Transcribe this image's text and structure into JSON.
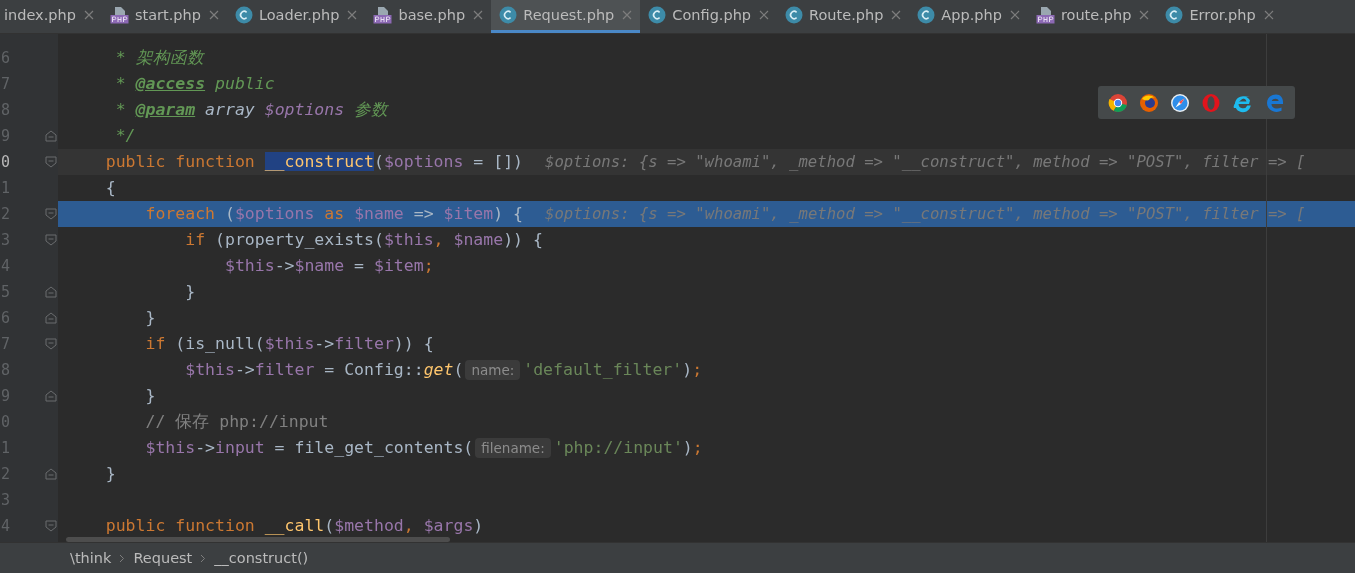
{
  "tabs": [
    {
      "label": "index.php",
      "kind": "plain",
      "selected": false
    },
    {
      "label": "start.php",
      "kind": "php",
      "selected": false
    },
    {
      "label": "Loader.php",
      "kind": "class",
      "selected": false
    },
    {
      "label": "base.php",
      "kind": "php",
      "selected": false
    },
    {
      "label": "Request.php",
      "kind": "class",
      "selected": true
    },
    {
      "label": "Config.php",
      "kind": "class",
      "selected": false
    },
    {
      "label": "Route.php",
      "kind": "class",
      "selected": false
    },
    {
      "label": "App.php",
      "kind": "class",
      "selected": false
    },
    {
      "label": "route.php",
      "kind": "php",
      "selected": false
    },
    {
      "label": "Error.php",
      "kind": "class",
      "selected": false
    }
  ],
  "editor": {
    "lines": [
      {
        "number": "6",
        "kind": "plain",
        "current": false,
        "execution": false,
        "tokens": [
          {
            "kind": "doc",
            "text": "     * 架构函数"
          }
        ]
      },
      {
        "number": "7",
        "kind": "plain",
        "current": false,
        "execution": false,
        "tokens": [
          {
            "kind": "doc",
            "text": "     * "
          },
          {
            "kind": "doctag",
            "text": "@access"
          },
          {
            "kind": "doc",
            "text": " public"
          }
        ]
      },
      {
        "number": "8",
        "kind": "plain",
        "current": false,
        "execution": false,
        "tokens": [
          {
            "kind": "doc",
            "text": "     * "
          },
          {
            "kind": "doctag",
            "text": "@param"
          },
          {
            "kind": "doctype",
            "text": " array "
          },
          {
            "kind": "docvar",
            "text": "$options"
          },
          {
            "kind": "doc",
            "text": " 参数"
          }
        ]
      },
      {
        "number": "9",
        "kind": "fold_end",
        "current": false,
        "execution": false,
        "tokens": [
          {
            "kind": "doc",
            "text": "     */"
          }
        ]
      },
      {
        "number": "0",
        "kind": "fold_start",
        "current": true,
        "execution": false,
        "tokens": [
          {
            "kind": "kw",
            "text": "    public function "
          },
          {
            "kind": "fnsel",
            "text": "__construct"
          },
          {
            "kind": "text",
            "text": "("
          },
          {
            "kind": "var",
            "text": "$options"
          },
          {
            "kind": "text",
            "text": " = [])"
          },
          {
            "kind": "hint",
            "text": "$options: {s => \"whoami\", _method => \"__construct\", method => \"POST\", filter => ["
          }
        ]
      },
      {
        "number": "1",
        "kind": "plain",
        "current": false,
        "execution": false,
        "tokens": [
          {
            "kind": "text",
            "text": "    {"
          }
        ]
      },
      {
        "number": "2",
        "kind": "fold_start",
        "current": false,
        "execution": true,
        "tokens": [
          {
            "kind": "kw",
            "text": "        foreach "
          },
          {
            "kind": "text",
            "text": "("
          },
          {
            "kind": "var",
            "text": "$options"
          },
          {
            "kind": "kw",
            "text": " as "
          },
          {
            "kind": "var",
            "text": "$name"
          },
          {
            "kind": "text",
            "text": " => "
          },
          {
            "kind": "var",
            "text": "$item"
          },
          {
            "kind": "text",
            "text": ") {"
          },
          {
            "kind": "hint",
            "text": "$options: {s => \"whoami\", _method => \"__construct\", method => \"POST\", filter => ["
          }
        ]
      },
      {
        "number": "3",
        "kind": "fold_start",
        "current": false,
        "execution": false,
        "tokens": [
          {
            "kind": "kw",
            "text": "            if "
          },
          {
            "kind": "text",
            "text": "(property_exists("
          },
          {
            "kind": "var",
            "text": "$this"
          },
          {
            "kind": "kw",
            "text": ", "
          },
          {
            "kind": "var",
            "text": "$name"
          },
          {
            "kind": "text",
            "text": ")) {"
          }
        ]
      },
      {
        "number": "4",
        "kind": "plain",
        "current": false,
        "execution": false,
        "tokens": [
          {
            "kind": "var",
            "text": "                $this"
          },
          {
            "kind": "text",
            "text": "->"
          },
          {
            "kind": "var",
            "text": "$name"
          },
          {
            "kind": "text",
            "text": " = "
          },
          {
            "kind": "var",
            "text": "$item"
          },
          {
            "kind": "kw",
            "text": ";"
          }
        ]
      },
      {
        "number": "5",
        "kind": "fold_end",
        "current": false,
        "execution": false,
        "tokens": [
          {
            "kind": "text",
            "text": "            }"
          }
        ]
      },
      {
        "number": "6",
        "kind": "fold_end",
        "current": false,
        "execution": false,
        "tokens": [
          {
            "kind": "text",
            "text": "        }"
          }
        ]
      },
      {
        "number": "7",
        "kind": "fold_start",
        "current": false,
        "execution": false,
        "tokens": [
          {
            "kind": "kw",
            "text": "        if "
          },
          {
            "kind": "text",
            "text": "(is_null("
          },
          {
            "kind": "var",
            "text": "$this"
          },
          {
            "kind": "text",
            "text": "->"
          },
          {
            "kind": "var",
            "text": "filter"
          },
          {
            "kind": "text",
            "text": ")) {"
          }
        ]
      },
      {
        "number": "8",
        "kind": "plain",
        "current": false,
        "execution": false,
        "tokens": [
          {
            "kind": "var",
            "text": "            $this"
          },
          {
            "kind": "text",
            "text": "->"
          },
          {
            "kind": "var",
            "text": "filter"
          },
          {
            "kind": "text",
            "text": " = Config::"
          },
          {
            "kind": "fn",
            "text": "get"
          },
          {
            "kind": "text",
            "text": "("
          },
          {
            "kind": "param",
            "text": "name:"
          },
          {
            "kind": "str",
            "text": "'default_filter'"
          },
          {
            "kind": "text",
            "text": ")"
          },
          {
            "kind": "kw",
            "text": ";"
          }
        ]
      },
      {
        "number": "9",
        "kind": "fold_end",
        "current": false,
        "execution": false,
        "tokens": [
          {
            "kind": "text",
            "text": "        }"
          }
        ]
      },
      {
        "number": "0",
        "kind": "plain",
        "current": false,
        "execution": false,
        "tokens": [
          {
            "kind": "comment",
            "text": "        // 保存 php://input"
          }
        ]
      },
      {
        "number": "1",
        "kind": "plain",
        "current": false,
        "execution": false,
        "tokens": [
          {
            "kind": "var",
            "text": "        $this"
          },
          {
            "kind": "text",
            "text": "->"
          },
          {
            "kind": "var",
            "text": "input"
          },
          {
            "kind": "text",
            "text": " = file_get_contents("
          },
          {
            "kind": "param",
            "text": "filename:"
          },
          {
            "kind": "str",
            "text": "'php://input'"
          },
          {
            "kind": "text",
            "text": ")"
          },
          {
            "kind": "kw",
            "text": ";"
          }
        ]
      },
      {
        "number": "2",
        "kind": "fold_end",
        "current": false,
        "execution": false,
        "tokens": [
          {
            "kind": "text",
            "text": "    }"
          }
        ]
      },
      {
        "number": "3",
        "kind": "plain",
        "current": false,
        "execution": false
      },
      {
        "number": "4",
        "kind": "fold_start",
        "current": false,
        "execution": false,
        "tokens": [
          {
            "kind": "kw",
            "text": "    public function "
          },
          {
            "kind": "fnname",
            "text": "__call"
          },
          {
            "kind": "text",
            "text": "("
          },
          {
            "kind": "var",
            "text": "$method"
          },
          {
            "kind": "kw",
            "text": ", "
          },
          {
            "kind": "var",
            "text": "$args"
          },
          {
            "kind": "text",
            "text": ")"
          }
        ]
      }
    ]
  },
  "browser_popup": {
    "browsers": [
      {
        "kind": "chrome"
      },
      {
        "kind": "firefox"
      },
      {
        "kind": "safari"
      },
      {
        "kind": "opera"
      },
      {
        "kind": "ie"
      },
      {
        "kind": "edge"
      }
    ]
  },
  "breadcrumbs": [
    "\\think",
    "Request",
    "__construct()"
  ]
}
